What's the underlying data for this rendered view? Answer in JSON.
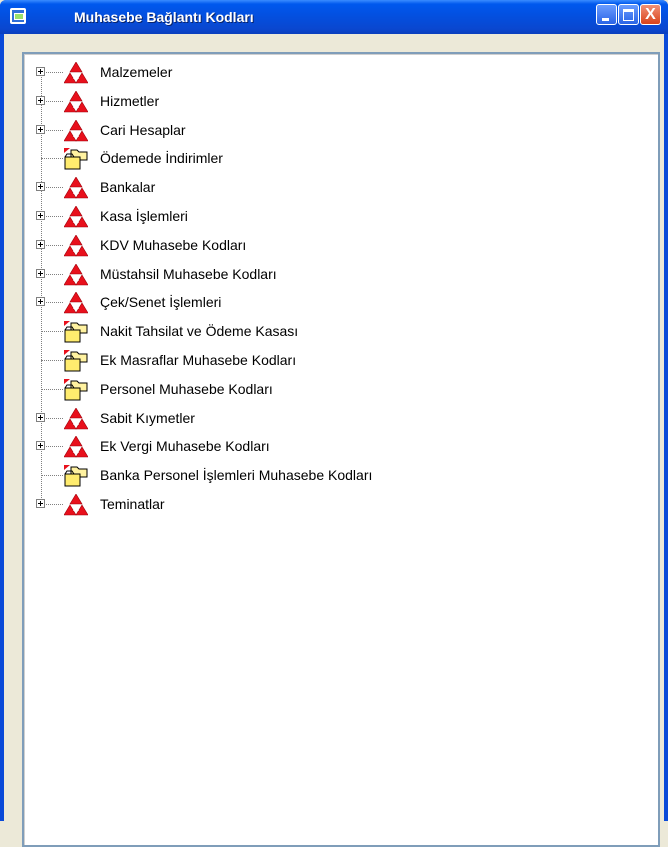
{
  "window": {
    "title": "Muhasebe Bağlantı Kodları",
    "accent": "#0a4ad8",
    "close_color": "#d9431b",
    "close_glyph": "X"
  },
  "tree": {
    "items": [
      {
        "label": "Malzemeler",
        "icon": "red-triangles-icon",
        "expandable": true
      },
      {
        "label": "Hizmetler",
        "icon": "red-triangles-icon",
        "expandable": true
      },
      {
        "label": "Cari Hesaplar",
        "icon": "red-triangles-icon",
        "expandable": true
      },
      {
        "label": "Ödemede İndirimler",
        "icon": "folder-icon",
        "expandable": false
      },
      {
        "label": "Bankalar",
        "icon": "red-triangles-icon",
        "expandable": true
      },
      {
        "label": "Kasa İşlemleri",
        "icon": "red-triangles-icon",
        "expandable": true
      },
      {
        "label": "KDV Muhasebe Kodları",
        "icon": "red-triangles-icon",
        "expandable": true
      },
      {
        "label": "Müstahsil Muhasebe Kodları",
        "icon": "red-triangles-icon",
        "expandable": true
      },
      {
        "label": "Çek/Senet İşlemleri",
        "icon": "red-triangles-icon",
        "expandable": true
      },
      {
        "label": "Nakit Tahsilat ve Ödeme Kasası",
        "icon": "folder-icon",
        "expandable": false
      },
      {
        "label": "Ek Masraflar Muhasebe Kodları",
        "icon": "folder-icon",
        "expandable": false
      },
      {
        "label": "Personel Muhasebe Kodları",
        "icon": "folder-icon",
        "expandable": false
      },
      {
        "label": "Sabit Kıymetler",
        "icon": "red-triangles-icon",
        "expandable": true
      },
      {
        "label": "Ek Vergi Muhasebe Kodları",
        "icon": "red-triangles-icon",
        "expandable": true
      },
      {
        "label": "Banka Personel İşlemleri Muhasebe Kodları",
        "icon": "folder-icon",
        "expandable": false
      },
      {
        "label": "Teminatlar",
        "icon": "red-triangles-icon",
        "expandable": true
      }
    ]
  }
}
